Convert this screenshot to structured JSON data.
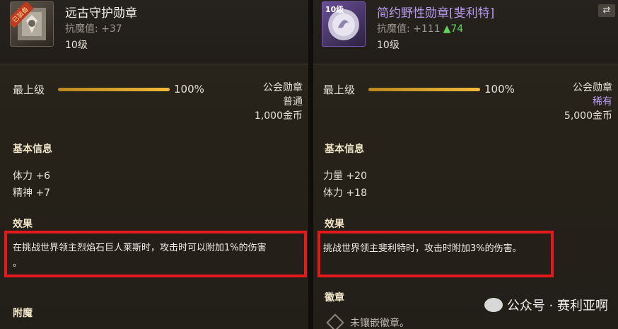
{
  "left": {
    "icon_tag": "已装备",
    "title": "远古守护勋章",
    "stat_line": "抗魔值: +37",
    "level": "10级",
    "max_label": "最上级",
    "progress_percent": 100,
    "progress_text": "100%",
    "guild_label": "公会勋章",
    "rarity": "普通",
    "price": "1,000金币",
    "basic_title": "基本信息",
    "stats": [
      "体力 +6",
      "精神 +7"
    ],
    "effect_title": "效果",
    "effect_line1": "在挑战世界领主烈焰石巨人莱斯时，攻击时可以附加1%的伤害",
    "effect_line2": "。",
    "enchant_title": "附魔"
  },
  "right": {
    "icon_tag": "10级",
    "title": "简约野性勋章[斐利特]",
    "stat_line": "抗魔值: +111",
    "stat_bonus": "▲74",
    "level": "10级",
    "max_label": "最上级",
    "progress_percent": 100,
    "progress_text": "100%",
    "guild_label": "公会勋章",
    "rarity": "稀有",
    "price": "5,000金币",
    "basic_title": "基本信息",
    "stats": [
      "力量 +20",
      "体力 +18"
    ],
    "effect_title": "效果",
    "effect_line1": "挑战世界领主斐利特时，攻击时附加3%的伤害。",
    "emblem_title": "徽章",
    "emblem_empty": "未镶嵌徽章。"
  },
  "watermark": "公众号 · 赛利亚啊",
  "colors": {
    "highlight_box": "#e5181b",
    "rare": "#b99bf0",
    "bonus": "#63d35c",
    "progress": "#f2b83a"
  }
}
